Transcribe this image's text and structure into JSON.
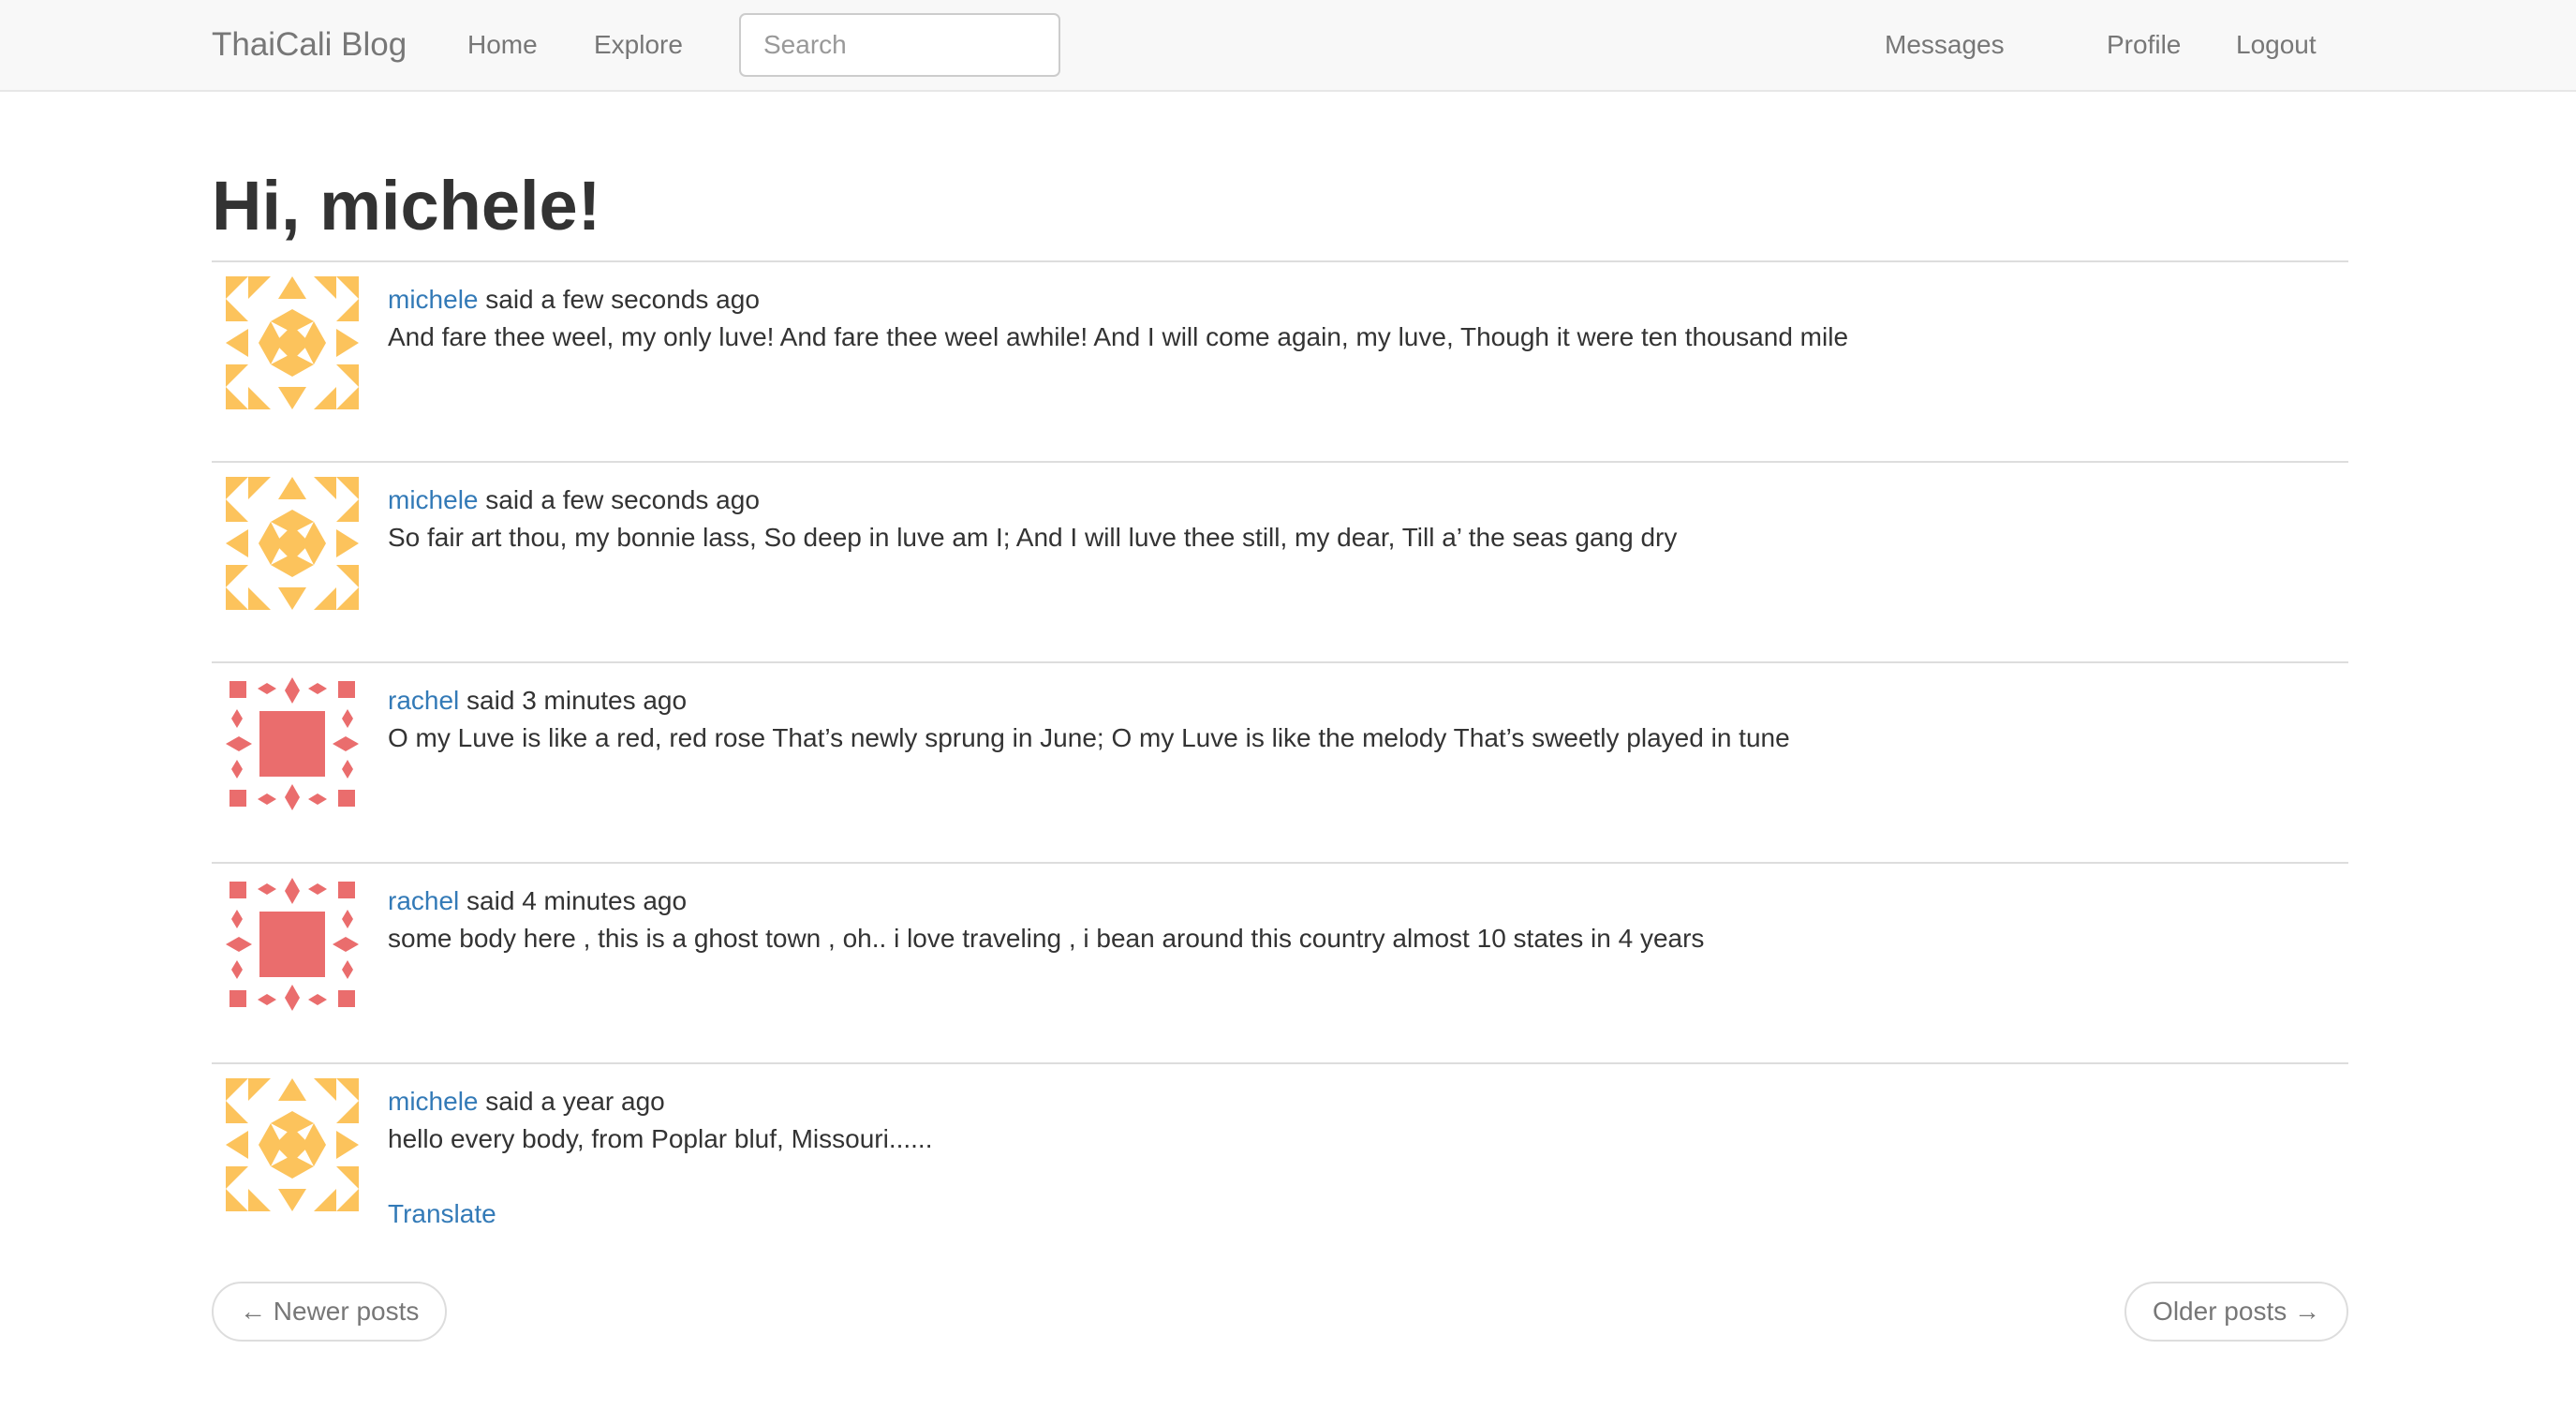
{
  "nav": {
    "brand": "ThaiCali Blog",
    "home": "Home",
    "explore": "Explore",
    "search_placeholder": "Search",
    "messages": "Messages",
    "profile": "Profile",
    "logout": "Logout"
  },
  "greeting": "Hi, michele!",
  "posts": [
    {
      "author": "michele",
      "when": "said a few seconds ago",
      "body": "And fare thee weel, my only luve! And fare thee weel awhile! And I will come again, my luve, Though it were ten thousand mile",
      "avatar_icon": "identicon-yellow-star",
      "avatar_color": "#fcc35c"
    },
    {
      "author": "michele",
      "when": "said a few seconds ago",
      "body": "So fair art thou, my bonnie lass, So deep in luve am I; And I will luve thee still, my dear, Till a’ the seas gang dry",
      "avatar_icon": "identicon-yellow-star",
      "avatar_color": "#fcc35c"
    },
    {
      "author": "rachel",
      "when": "said 3 minutes ago",
      "body": "O my Luve is like a red, red rose That’s newly sprung in June; O my Luve is like the melody That’s sweetly played in tune",
      "avatar_icon": "identicon-red-square",
      "avatar_color": "#ea6d6d"
    },
    {
      "author": "rachel",
      "when": "said 4 minutes ago",
      "body": "some body here , this is a ghost town , oh.. i love traveling , i bean around this country almost 10 states in 4 years",
      "avatar_icon": "identicon-red-square",
      "avatar_color": "#ea6d6d"
    },
    {
      "author": "michele",
      "when": "said a year ago",
      "body": "hello every body, from Poplar bluf, Missouri......",
      "translate": "Translate",
      "avatar_icon": "identicon-yellow-star",
      "avatar_color": "#fcc35c"
    }
  ],
  "pager": {
    "newer": "← Newer posts",
    "older": "Older posts →"
  },
  "colors": {
    "link": "#337ab7",
    "navbar_bg": "#f8f8f8"
  }
}
